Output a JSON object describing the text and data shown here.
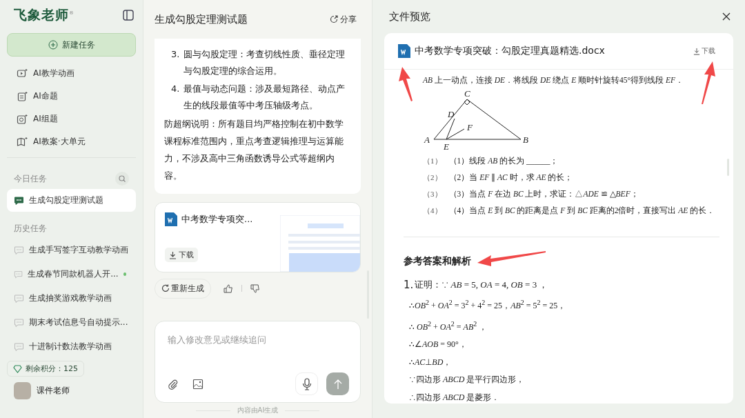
{
  "sidebar": {
    "logo": "飞象老师",
    "logo_mark": "®",
    "new_task": "新建任务",
    "tools": [
      {
        "label": "AI教学动画",
        "kind": "animation"
      },
      {
        "label": "AI命题",
        "kind": "question"
      },
      {
        "label": "AI组题",
        "kind": "compose"
      },
      {
        "label": "AI教案·大单元",
        "kind": "lesson"
      }
    ],
    "today": {
      "title": "今日任务",
      "items": [
        {
          "label": "生成勾股定理测试题",
          "selected": true
        }
      ]
    },
    "history": {
      "title": "历史任务",
      "items": [
        {
          "label": "生成手写签字互动教学动画",
          "selected": false,
          "unread": false
        },
        {
          "label": "生成春节同款机器人开...",
          "selected": false,
          "unread": true
        },
        {
          "label": "生成抽奖游戏教学动画",
          "selected": false,
          "unread": false
        },
        {
          "label": "期末考试信息号自动提示...",
          "selected": false,
          "unread": false
        },
        {
          "label": "十进制计数法教学动画",
          "selected": false,
          "unread": false
        }
      ]
    },
    "points": "剩余积分：125",
    "user": {
      "name": "课件老师"
    }
  },
  "chat": {
    "title": "生成勾股定理测试题",
    "share": "分享",
    "list": [
      {
        "number": "3.",
        "text": "圆与勾股定理：考查切线性质、垂径定理与勾股定理的综合运用。"
      },
      {
        "number": "4.",
        "text": "最值与动态问题：涉及最短路径、动点产生的线段最值等中考压轴级考点。"
      }
    ],
    "note": "防超纲说明：所有题目均严格控制在初中数学课程标准范围内，重点考查逻辑推理与运算能力，不涉及高中三角函数诱导公式等超纲内容。",
    "file": {
      "name": "中考数学专项突...",
      "download": "下载"
    },
    "regenerate": "重新生成",
    "input": {
      "placeholder": "输入修改意见或继续追问"
    },
    "disclaimer": "内容由AI生成"
  },
  "preview": {
    "title": "文件预览",
    "file": {
      "name": "中考数学专项突破：勾股定理真题精选.docx",
      "download": "下载"
    },
    "intro": "*AB* 上一动点，连接 *DE*．将线段 *DE* 绕点 *E* 顺时针旋转45°得到线段 *EF*．",
    "figure_labels": [
      "A",
      "B",
      "C",
      "D",
      "E",
      "F"
    ],
    "questions": [
      {
        "number": "（1）",
        "text": "（1）线段 *AB* 的长为 ______；"
      },
      {
        "number": "（2）",
        "text": "（2）当 *EF* ∥ *AC* 时，求 *AE* 的长；"
      },
      {
        "number": "（3）",
        "text": "（3）当点 *F* 在边 *BC* 上时，求证：△*ADE* ≌ △*BEF*；"
      },
      {
        "number": "（4）",
        "text": "（4）当点 *E* 到 *BC* 的距离是点 *F* 到 *BC* 距离的2倍时，直接写出 *AE* 的长．"
      }
    ],
    "answer_title": "参考答案和解析",
    "answer_number": "1.",
    "answer_first": "证明：∵ *AB* = 5, *OA* = 4, *OB* = 3 ，",
    "answer_lines": [
      "∴*OB*$^{2}$ + *OA*$^{2}$ = 3$^{2}$ + 4$^{2}$ = 25，*AB*$^{2}$ = 5$^{2}$ = 25，",
      "∴ *OB*$^{2}$ + *OA*$^{2}$ = *AB*$^{2}$ ，",
      "∴∠*AOB* = 90°，",
      "∴*AC*⊥*BD*，",
      "∵四边形 *ABCD* 是平行四边形，",
      "∴四边形 *ABCD* 是菱形．"
    ]
  }
}
